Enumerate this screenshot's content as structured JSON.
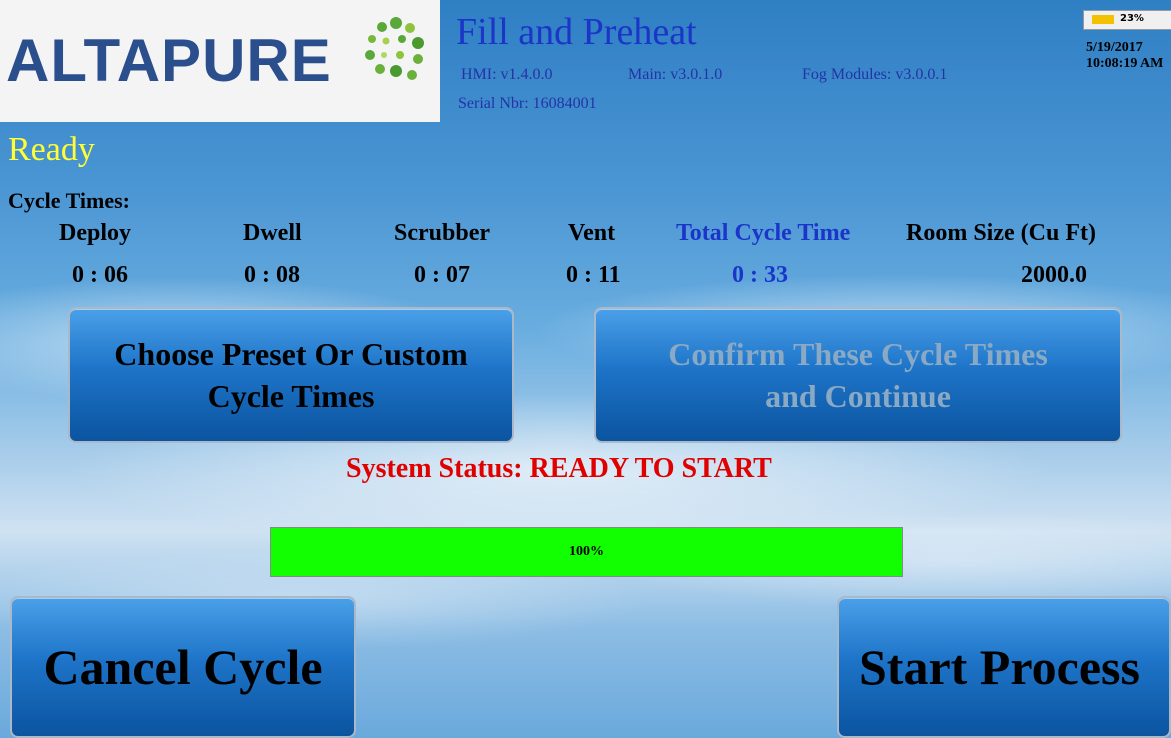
{
  "header": {
    "logo_text": "ALTAPURE",
    "screen_title": "Fill and Preheat",
    "hmi_version": "HMI: v1.4.0.0",
    "main_version": "Main: v3.0.1.0",
    "fog_version": "Fog Modules: v3.0.0.1",
    "serial": "Serial  Nbr: 16084001",
    "battery_text": "23%",
    "battery_percent": 23,
    "date": "5/19/2017",
    "time": "10:08:19 AM"
  },
  "state_label": "Ready",
  "cycle_times": {
    "label": "Cycle Times:",
    "columns": [
      {
        "head": "Deploy",
        "value": "0 : 06"
      },
      {
        "head": "Dwell",
        "value": "0 : 08"
      },
      {
        "head": "Scrubber",
        "value": "0 : 07"
      },
      {
        "head": "Vent",
        "value": "0 : 11"
      },
      {
        "head": "Total Cycle Time",
        "value": "0  :  33"
      },
      {
        "head": "Room Size (Cu Ft)",
        "value": "2000.0"
      }
    ]
  },
  "buttons": {
    "choose_line1": "Choose Preset Or Custom",
    "choose_line2": "Cycle Times",
    "confirm_line1": "Confirm These Cycle Times",
    "confirm_line2": "and Continue",
    "cancel": "Cancel Cycle",
    "start": "Start Process"
  },
  "system_status": "System Status:  READY TO START",
  "progress": {
    "text": "100%",
    "percent": 100
  },
  "colors": {
    "title_blue": "#1a35c8",
    "ready_yellow": "#ffff33",
    "status_red": "#e00000",
    "progress_green": "#11ff00"
  }
}
